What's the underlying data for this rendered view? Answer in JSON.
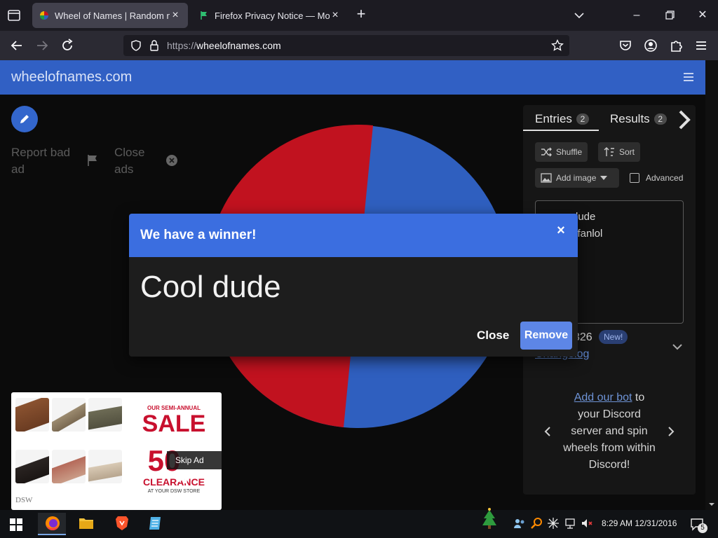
{
  "browser": {
    "tabs": [
      {
        "title": "Wheel of Names | Random nam",
        "active": true
      },
      {
        "title": "Firefox Privacy Notice — Mozill",
        "active": false
      }
    ],
    "url_protocol": "https://",
    "url_host": "wheelofnames.com",
    "icons": [
      "tab-list-icon",
      "close-icon",
      "plus-icon",
      "chevron-down-icon",
      "minimize-icon",
      "maximize-icon",
      "back-icon",
      "forward-icon",
      "reload-icon",
      "shield-icon",
      "lock-icon",
      "star-icon",
      "pocket-icon",
      "account-icon",
      "extensions-icon",
      "menu-icon"
    ]
  },
  "site": {
    "logo": "wheelofnames.com",
    "report_ad": "Report bad ad",
    "close_ads": "Close ads",
    "wheel_colors": {
      "red": "#c1121f",
      "blue": "#2f5fbf"
    }
  },
  "panel": {
    "tabs": [
      {
        "label": "Entries",
        "count": "2"
      },
      {
        "label": "Results",
        "count": "2"
      }
    ],
    "shuffle": "Shuffle",
    "sort": "Sort",
    "add_image": "Add image",
    "advanced": "Advanced",
    "entries": [
      "dude",
      "xfanlol"
    ],
    "version": "326",
    "new_badge": "New!",
    "changelog": "Changelog",
    "discord_link": "Add our bot",
    "discord_text": " to your Discord server and spin wheels from within Discord!"
  },
  "dialog": {
    "title": "We have a winner!",
    "winner": "Cool dude",
    "close_label": "Close",
    "remove_label": "Remove",
    "accent": "#3b6ee0"
  },
  "ad": {
    "semi_annual": "OUR SEMI-ANNUAL",
    "sale": "SALE",
    "percent": "50",
    "clearance": "CLEARANCE",
    "store": "AT YOUR DSW STORE",
    "skip": "Skip Ad",
    "brand": "DSW"
  },
  "taskbar": {
    "time": "8:29 AM 12/31/2016",
    "notification_count": "5"
  }
}
